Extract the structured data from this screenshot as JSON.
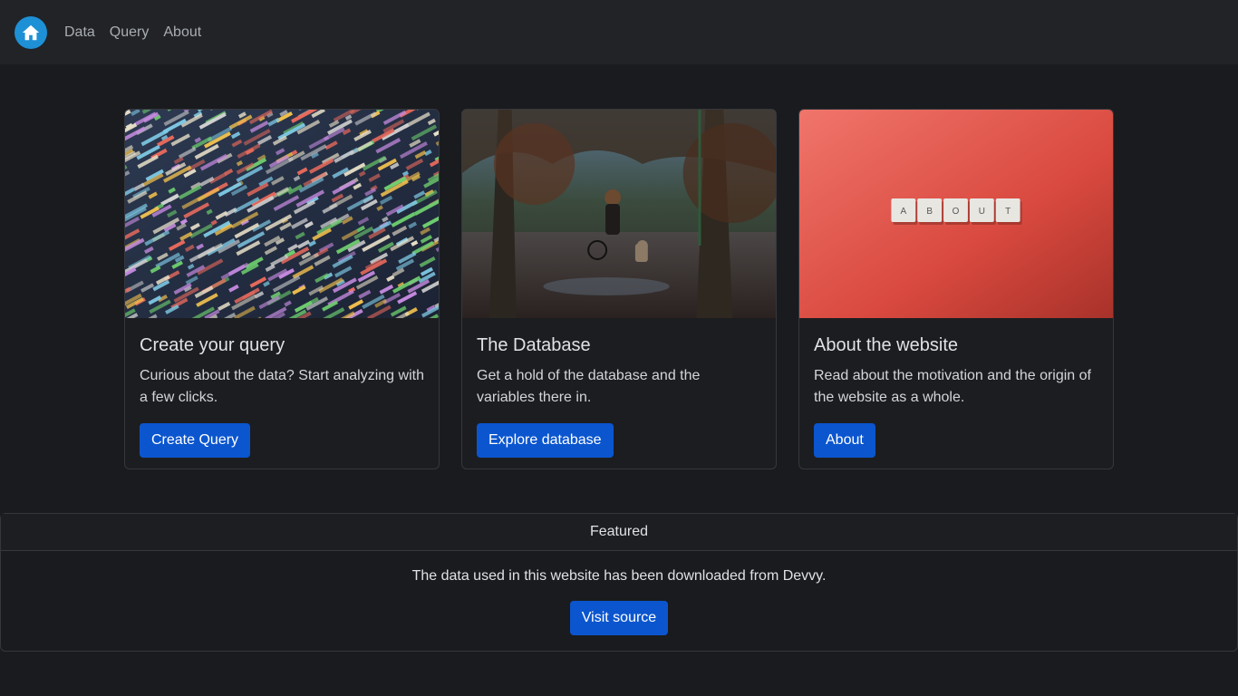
{
  "nav": {
    "logo_icon": "home-icon",
    "links": [
      "Data",
      "Query",
      "About"
    ]
  },
  "cards": [
    {
      "image": "code-screen-photo",
      "title": "Create your query",
      "text": "Curious about the data? Start analyzing with a few clicks.",
      "button": "Create Query"
    },
    {
      "image": "park-walk-photo",
      "title": "The Database",
      "text": "Get a hold of the database and the variables there in.",
      "button": "Explore database"
    },
    {
      "image": "about-tiles-photo",
      "title": "About the website",
      "text": "Read about the motivation and the origin of the website as a whole.",
      "button": "About",
      "tiles": [
        "A",
        "B",
        "O",
        "U",
        "T"
      ]
    }
  ],
  "featured": {
    "header": "Featured",
    "text": "The data used in this website has been downloaded from Devvy.",
    "button": "Visit source"
  },
  "colors": {
    "background": "#1a1b1e",
    "navbar": "#212327",
    "accent": "#0b56cf",
    "logo": "#1e90d6"
  }
}
